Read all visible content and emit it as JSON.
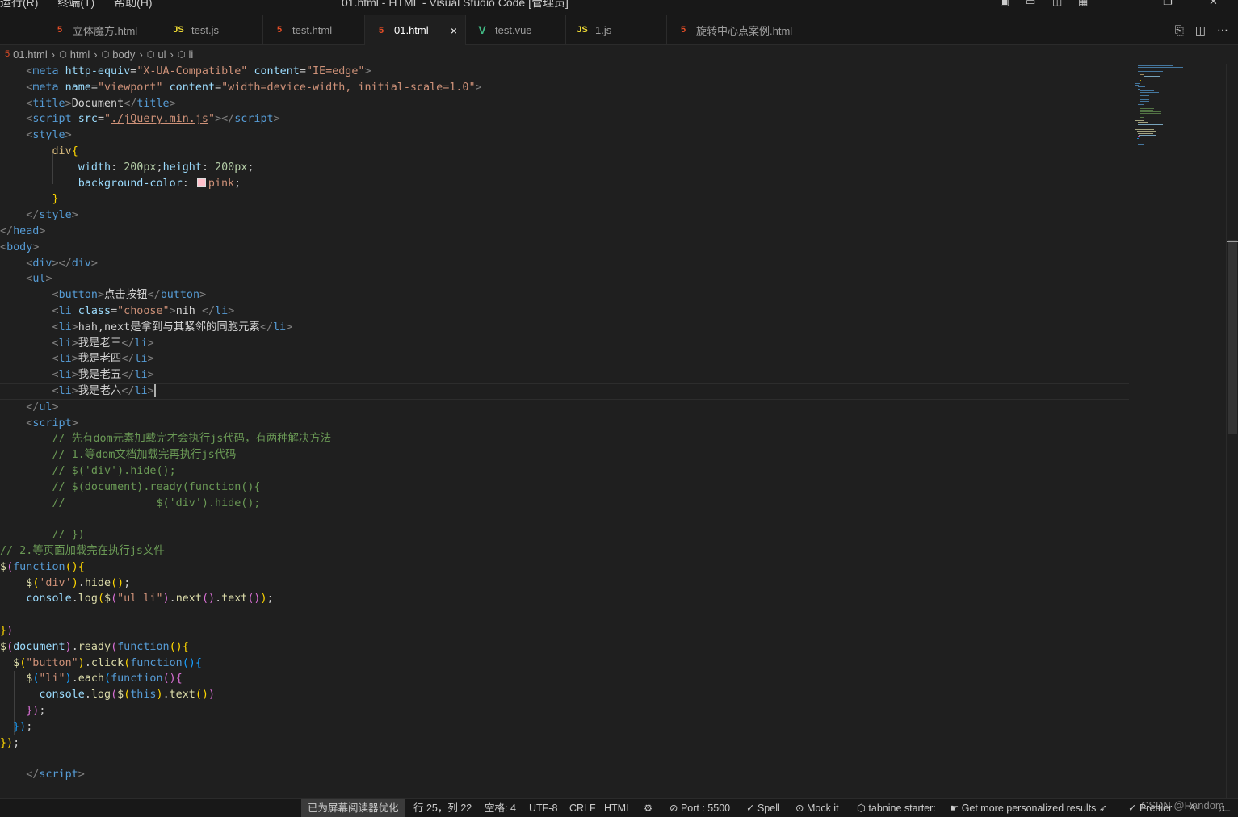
{
  "window": {
    "menu": [
      "运行(R)",
      "终端(T)",
      "帮助(H)"
    ],
    "title": "01.html - HTML - Visual Studio Code [管理员]"
  },
  "tabs": [
    {
      "label": "立体魔方.html",
      "icon": "html-file-icon",
      "active": false
    },
    {
      "label": "test.js",
      "icon": "js-file-icon",
      "active": false
    },
    {
      "label": "test.html",
      "icon": "html-file-icon",
      "active": false
    },
    {
      "label": "01.html",
      "icon": "html-file-icon",
      "active": true
    },
    {
      "label": "test.vue",
      "icon": "vue-file-icon",
      "active": false
    },
    {
      "label": "1.js",
      "icon": "js-file-icon",
      "active": false
    },
    {
      "label": "旋转中心点案例.html",
      "icon": "html-file-icon",
      "active": false
    }
  ],
  "tab_icons": {
    "html": "5",
    "js": "JS",
    "vue": "V",
    "close": "×"
  },
  "tab_actions": [
    "open-preview-icon",
    "split-editor-icon",
    "more-actions-icon"
  ],
  "breadcrumb": [
    "01.html",
    "html",
    "body",
    "ul",
    "li"
  ],
  "editor": {
    "lines": [
      [
        [
          "t-tag",
          "    <"
        ],
        [
          "t-tagname",
          "meta"
        ],
        [
          "t-plain",
          " "
        ],
        [
          "t-attr",
          "http-equiv"
        ],
        [
          "t-plain",
          "="
        ],
        [
          "t-str",
          "\"X-UA-Compatible\""
        ],
        [
          "t-plain",
          " "
        ],
        [
          "t-attr",
          "content"
        ],
        [
          "t-plain",
          "="
        ],
        [
          "t-str",
          "\"IE=edge\""
        ],
        [
          "t-tag",
          ">"
        ]
      ],
      [
        [
          "t-tag",
          "    <"
        ],
        [
          "t-tagname",
          "meta"
        ],
        [
          "t-plain",
          " "
        ],
        [
          "t-attr",
          "name"
        ],
        [
          "t-plain",
          "="
        ],
        [
          "t-str",
          "\"viewport\""
        ],
        [
          "t-plain",
          " "
        ],
        [
          "t-attr",
          "content"
        ],
        [
          "t-plain",
          "="
        ],
        [
          "t-str",
          "\"width=device-width, initial-scale=1.0\""
        ],
        [
          "t-tag",
          ">"
        ]
      ],
      [
        [
          "t-tag",
          "    <"
        ],
        [
          "t-tagname",
          "title"
        ],
        [
          "t-tag",
          ">"
        ],
        [
          "t-text",
          "Document"
        ],
        [
          "t-tag",
          "</"
        ],
        [
          "t-tagname",
          "title"
        ],
        [
          "t-tag",
          ">"
        ]
      ],
      [
        [
          "t-tag",
          "    <"
        ],
        [
          "t-tagname",
          "script"
        ],
        [
          "t-plain",
          " "
        ],
        [
          "t-attr",
          "src"
        ],
        [
          "t-plain",
          "="
        ],
        [
          "t-str",
          "\""
        ],
        [
          "t-str link",
          "./jQuery.min.js"
        ],
        [
          "t-str",
          "\""
        ],
        [
          "t-tag",
          "></"
        ],
        [
          "t-tagname",
          "script"
        ],
        [
          "t-tag",
          ">"
        ]
      ],
      [
        [
          "t-tag",
          "    <"
        ],
        [
          "t-tagname",
          "style"
        ],
        [
          "t-tag",
          ">"
        ]
      ],
      [
        [
          "t-sel",
          "        div"
        ],
        [
          "t-b1",
          "{"
        ]
      ],
      [
        [
          "t-prop",
          "            width"
        ],
        [
          "t-plain",
          ": "
        ],
        [
          "t-num",
          "200px"
        ],
        [
          "t-plain",
          ";"
        ],
        [
          "t-prop",
          "height"
        ],
        [
          "t-plain",
          ": "
        ],
        [
          "t-num",
          "200px"
        ],
        [
          "t-plain",
          ";"
        ]
      ],
      [
        [
          "t-prop",
          "            background-color"
        ],
        [
          "t-plain",
          ": "
        ],
        [
          "swatch",
          ""
        ],
        [
          "t-str",
          "pink"
        ],
        [
          "t-plain",
          ";"
        ]
      ],
      [
        [
          "t-b1",
          "        }"
        ]
      ],
      [
        [
          "t-tag",
          "    </"
        ],
        [
          "t-tagname",
          "style"
        ],
        [
          "t-tag",
          ">"
        ]
      ],
      [
        [
          "t-tag",
          "</"
        ],
        [
          "t-tagname",
          "head"
        ],
        [
          "t-tag",
          ">"
        ]
      ],
      [
        [
          "t-tag",
          "<"
        ],
        [
          "t-tagname",
          "body"
        ],
        [
          "t-tag",
          ">"
        ]
      ],
      [
        [
          "t-tag",
          "    <"
        ],
        [
          "t-tagname",
          "div"
        ],
        [
          "t-tag",
          "></"
        ],
        [
          "t-tagname",
          "div"
        ],
        [
          "t-tag",
          ">"
        ]
      ],
      [
        [
          "t-tag",
          "    <"
        ],
        [
          "t-tagname",
          "ul"
        ],
        [
          "t-tag",
          ">"
        ]
      ],
      [
        [
          "t-tag",
          "        <"
        ],
        [
          "t-tagname",
          "button"
        ],
        [
          "t-tag",
          ">"
        ],
        [
          "t-text",
          "点击按钮"
        ],
        [
          "t-tag",
          "</"
        ],
        [
          "t-tagname",
          "button"
        ],
        [
          "t-tag",
          ">"
        ]
      ],
      [
        [
          "t-tag",
          "        <"
        ],
        [
          "t-tagname",
          "li"
        ],
        [
          "t-plain",
          " "
        ],
        [
          "t-attr",
          "class"
        ],
        [
          "t-plain",
          "="
        ],
        [
          "t-str",
          "\"choose\""
        ],
        [
          "t-tag",
          ">"
        ],
        [
          "t-text",
          "nih "
        ],
        [
          "t-tag",
          "</"
        ],
        [
          "t-tagname",
          "li"
        ],
        [
          "t-tag",
          ">"
        ]
      ],
      [
        [
          "t-tag",
          "        <"
        ],
        [
          "t-tagname",
          "li"
        ],
        [
          "t-tag",
          ">"
        ],
        [
          "t-text",
          "hah,next是拿到与其紧邻的同胞元素"
        ],
        [
          "t-tag",
          "</"
        ],
        [
          "t-tagname",
          "li"
        ],
        [
          "t-tag",
          ">"
        ]
      ],
      [
        [
          "t-tag",
          "        <"
        ],
        [
          "t-tagname",
          "li"
        ],
        [
          "t-tag",
          ">"
        ],
        [
          "t-text",
          "我是老三"
        ],
        [
          "t-tag",
          "</"
        ],
        [
          "t-tagname",
          "li"
        ],
        [
          "t-tag",
          ">"
        ]
      ],
      [
        [
          "t-tag",
          "        <"
        ],
        [
          "t-tagname",
          "li"
        ],
        [
          "t-tag",
          ">"
        ],
        [
          "t-text",
          "我是老四"
        ],
        [
          "t-tag",
          "</"
        ],
        [
          "t-tagname",
          "li"
        ],
        [
          "t-tag",
          ">"
        ]
      ],
      [
        [
          "t-tag",
          "        <"
        ],
        [
          "t-tagname",
          "li"
        ],
        [
          "t-tag",
          ">"
        ],
        [
          "t-text",
          "我是老五"
        ],
        [
          "t-tag",
          "</"
        ],
        [
          "t-tagname",
          "li"
        ],
        [
          "t-tag",
          ">"
        ]
      ],
      [
        [
          "t-tag",
          "        <"
        ],
        [
          "t-tagname",
          "li"
        ],
        [
          "t-tag",
          ">"
        ],
        [
          "t-text",
          "我是老六"
        ],
        [
          "t-tag",
          "</"
        ],
        [
          "t-tagname",
          "li"
        ],
        [
          "t-tag",
          ">"
        ],
        [
          "cursor",
          ""
        ]
      ],
      [
        [
          "t-tag",
          "    </"
        ],
        [
          "t-tagname",
          "ul"
        ],
        [
          "t-tag",
          ">"
        ]
      ],
      [
        [
          "t-tag",
          "    <"
        ],
        [
          "t-tagname",
          "script"
        ],
        [
          "t-tag",
          ">"
        ]
      ],
      [
        [
          "t-cmt",
          "        // 先有dom元素加载完才会执行js代码，有两种解决方法"
        ]
      ],
      [
        [
          "t-cmt",
          "        // 1.等dom文档加载完再执行js代码"
        ]
      ],
      [
        [
          "t-cmt",
          "        // $('div').hide();"
        ]
      ],
      [
        [
          "t-cmt",
          "        // $(document).ready(function(){"
        ]
      ],
      [
        [
          "t-cmt",
          "        //              $('div').hide();"
        ]
      ],
      [
        [
          "t-plain",
          ""
        ]
      ],
      [
        [
          "t-cmt",
          "        // })"
        ]
      ],
      [
        [
          "t-cmt",
          "// 2.等页面加载完在执行js文件"
        ]
      ],
      [
        [
          "t-fn",
          "$"
        ],
        [
          "t-b2",
          "("
        ],
        [
          "t-kw",
          "function"
        ],
        [
          "t-b1",
          "(){"
        ]
      ],
      [
        [
          "t-fn",
          "    $"
        ],
        [
          "t-b1",
          "("
        ],
        [
          "t-str",
          "'div'"
        ],
        [
          "t-b1",
          ")"
        ],
        [
          "t-plain",
          "."
        ],
        [
          "t-fn",
          "hide"
        ],
        [
          "t-b1",
          "()"
        ],
        [
          "t-plain",
          ";"
        ]
      ],
      [
        [
          "t-attr",
          "    console"
        ],
        [
          "t-plain",
          "."
        ],
        [
          "t-fn",
          "log"
        ],
        [
          "t-b1",
          "("
        ],
        [
          "t-fn",
          "$"
        ],
        [
          "t-b2",
          "("
        ],
        [
          "t-str",
          "\"ul li\""
        ],
        [
          "t-b2",
          ")"
        ],
        [
          "t-plain",
          "."
        ],
        [
          "t-fn",
          "next"
        ],
        [
          "t-b2",
          "()"
        ],
        [
          "t-plain",
          "."
        ],
        [
          "t-fn",
          "text"
        ],
        [
          "t-b2",
          "()"
        ],
        [
          "t-b1",
          ")"
        ],
        [
          "t-plain",
          ";"
        ]
      ],
      [
        [
          "t-plain",
          ""
        ]
      ],
      [
        [
          "t-b1",
          "}"
        ],
        [
          "t-b2",
          ")"
        ]
      ],
      [
        [
          "t-fn",
          "$"
        ],
        [
          "t-b2",
          "("
        ],
        [
          "t-attr",
          "document"
        ],
        [
          "t-b2",
          ")"
        ],
        [
          "t-plain",
          "."
        ],
        [
          "t-fn",
          "ready"
        ],
        [
          "t-b2",
          "("
        ],
        [
          "t-kw",
          "function"
        ],
        [
          "t-b1",
          "(){"
        ]
      ],
      [
        [
          "t-fn",
          "  $"
        ],
        [
          "t-b1",
          "("
        ],
        [
          "t-str",
          "\"button\""
        ],
        [
          "t-b1",
          ")"
        ],
        [
          "t-plain",
          "."
        ],
        [
          "t-fn",
          "click"
        ],
        [
          "t-b1",
          "("
        ],
        [
          "t-kw",
          "function"
        ],
        [
          "t-b3",
          "(){"
        ]
      ],
      [
        [
          "t-fn",
          "    $"
        ],
        [
          "t-b3",
          "("
        ],
        [
          "t-str",
          "\"li\""
        ],
        [
          "t-b3",
          ")"
        ],
        [
          "t-plain",
          "."
        ],
        [
          "t-fn",
          "each"
        ],
        [
          "t-b3",
          "("
        ],
        [
          "t-kw",
          "function"
        ],
        [
          "t-b2",
          "(){"
        ]
      ],
      [
        [
          "t-attr",
          "      console"
        ],
        [
          "t-plain",
          "."
        ],
        [
          "t-fn",
          "log"
        ],
        [
          "t-b2",
          "("
        ],
        [
          "t-fn",
          "$"
        ],
        [
          "t-b1",
          "("
        ],
        [
          "t-kw",
          "this"
        ],
        [
          "t-b1",
          ")"
        ],
        [
          "t-plain",
          "."
        ],
        [
          "t-fn",
          "text"
        ],
        [
          "t-b1",
          "()"
        ],
        [
          "t-b2",
          ")"
        ]
      ],
      [
        [
          "t-b2",
          "    })"
        ],
        [
          "t-plain",
          ";"
        ]
      ],
      [
        [
          "t-b3",
          "  })"
        ],
        [
          "t-plain",
          ";"
        ]
      ],
      [
        [
          "t-b1",
          "})"
        ],
        [
          "t-plain",
          ";"
        ]
      ],
      [
        [
          "t-plain",
          ""
        ]
      ],
      [
        [
          "t-tag",
          "    </"
        ],
        [
          "t-tagname",
          "script"
        ],
        [
          "t-tag",
          ">"
        ]
      ]
    ],
    "current_line": 20
  },
  "statusbar": {
    "reader": "已为屏幕阅读器优化",
    "position": "行 25，列 22",
    "spaces": "空格: 4",
    "encoding": "UTF-8",
    "eol": "CRLF",
    "language": "HTML",
    "port": "Port : 5500",
    "spell": "Spell",
    "mock": "Mock it",
    "tabnine": "tabnine starter:",
    "personalized": "Get more personalized results",
    "prettier": "Prettier",
    "watermark": "CSDN @Random_"
  },
  "colors": {
    "accent": "#0078d4",
    "editor_bg": "#1f1f1f",
    "pink_swatch": "#ffc0cb"
  }
}
